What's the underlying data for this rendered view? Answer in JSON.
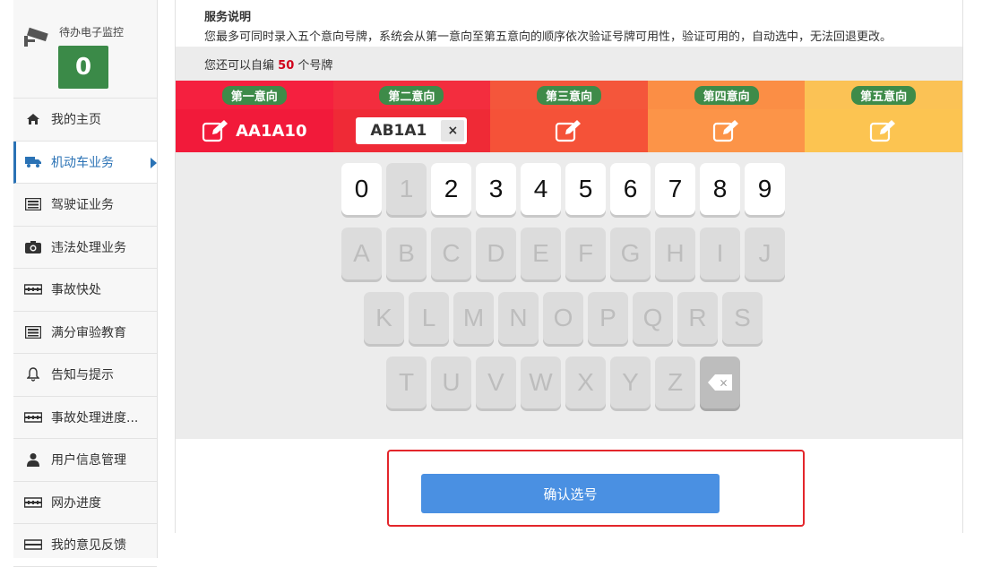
{
  "sidebar": {
    "monitor_label": "待办电子监控",
    "monitor_count": "0",
    "items": [
      {
        "label": "我的主页",
        "icon": "home-icon"
      },
      {
        "label": "机动车业务",
        "icon": "truck-icon",
        "active": true
      },
      {
        "label": "驾驶证业务",
        "icon": "license-card-icon"
      },
      {
        "label": "违法处理业务",
        "icon": "camera-icon"
      },
      {
        "label": "事故快处",
        "icon": "ticket-icon"
      },
      {
        "label": "满分审验教育",
        "icon": "list-card-icon"
      },
      {
        "label": "告知与提示",
        "icon": "bell-icon"
      },
      {
        "label": "事故处理进度...",
        "icon": "ticket-icon"
      },
      {
        "label": "用户信息管理",
        "icon": "user-icon"
      },
      {
        "label": "网办进度",
        "icon": "ticket-icon"
      },
      {
        "label": "我的意见反馈",
        "icon": "feedback-icon"
      }
    ]
  },
  "info": {
    "title": "服务说明",
    "desc": "您最多可同时录入五个意向号牌，系统会从第一意向至第五意向的顺序依次验证号牌可用性，验证可用的，自动选中，无法回退更改。"
  },
  "quota": {
    "prefix": "您还可以自编",
    "count": "50",
    "suffix": "个号牌"
  },
  "plates": [
    {
      "label": "第一意向",
      "value": "AA1A10",
      "state": "filled"
    },
    {
      "label": "第二意向",
      "value": "AB1A1",
      "state": "editing"
    },
    {
      "label": "第三意向",
      "value": "",
      "state": "empty"
    },
    {
      "label": "第四意向",
      "value": "",
      "state": "empty"
    },
    {
      "label": "第五意向",
      "value": "",
      "state": "empty"
    }
  ],
  "edit_clear": "×",
  "keyboard": {
    "digits": [
      "0",
      "1",
      "2",
      "3",
      "4",
      "5",
      "6",
      "7",
      "8",
      "9"
    ],
    "disabled_digits": [
      "1"
    ],
    "row2": [
      "A",
      "B",
      "C",
      "D",
      "E",
      "F",
      "G",
      "H",
      "I",
      "J"
    ],
    "row3": [
      "K",
      "L",
      "M",
      "N",
      "O",
      "P",
      "Q",
      "R",
      "S"
    ],
    "row4": [
      "T",
      "U",
      "V",
      "W",
      "X",
      "Y",
      "Z"
    ],
    "backspace_label": "×"
  },
  "confirm_label": "确认选号",
  "colors": {
    "accent": "#4a90e2",
    "badge_green": "#3b8a48",
    "highlight": "#e3262b"
  }
}
